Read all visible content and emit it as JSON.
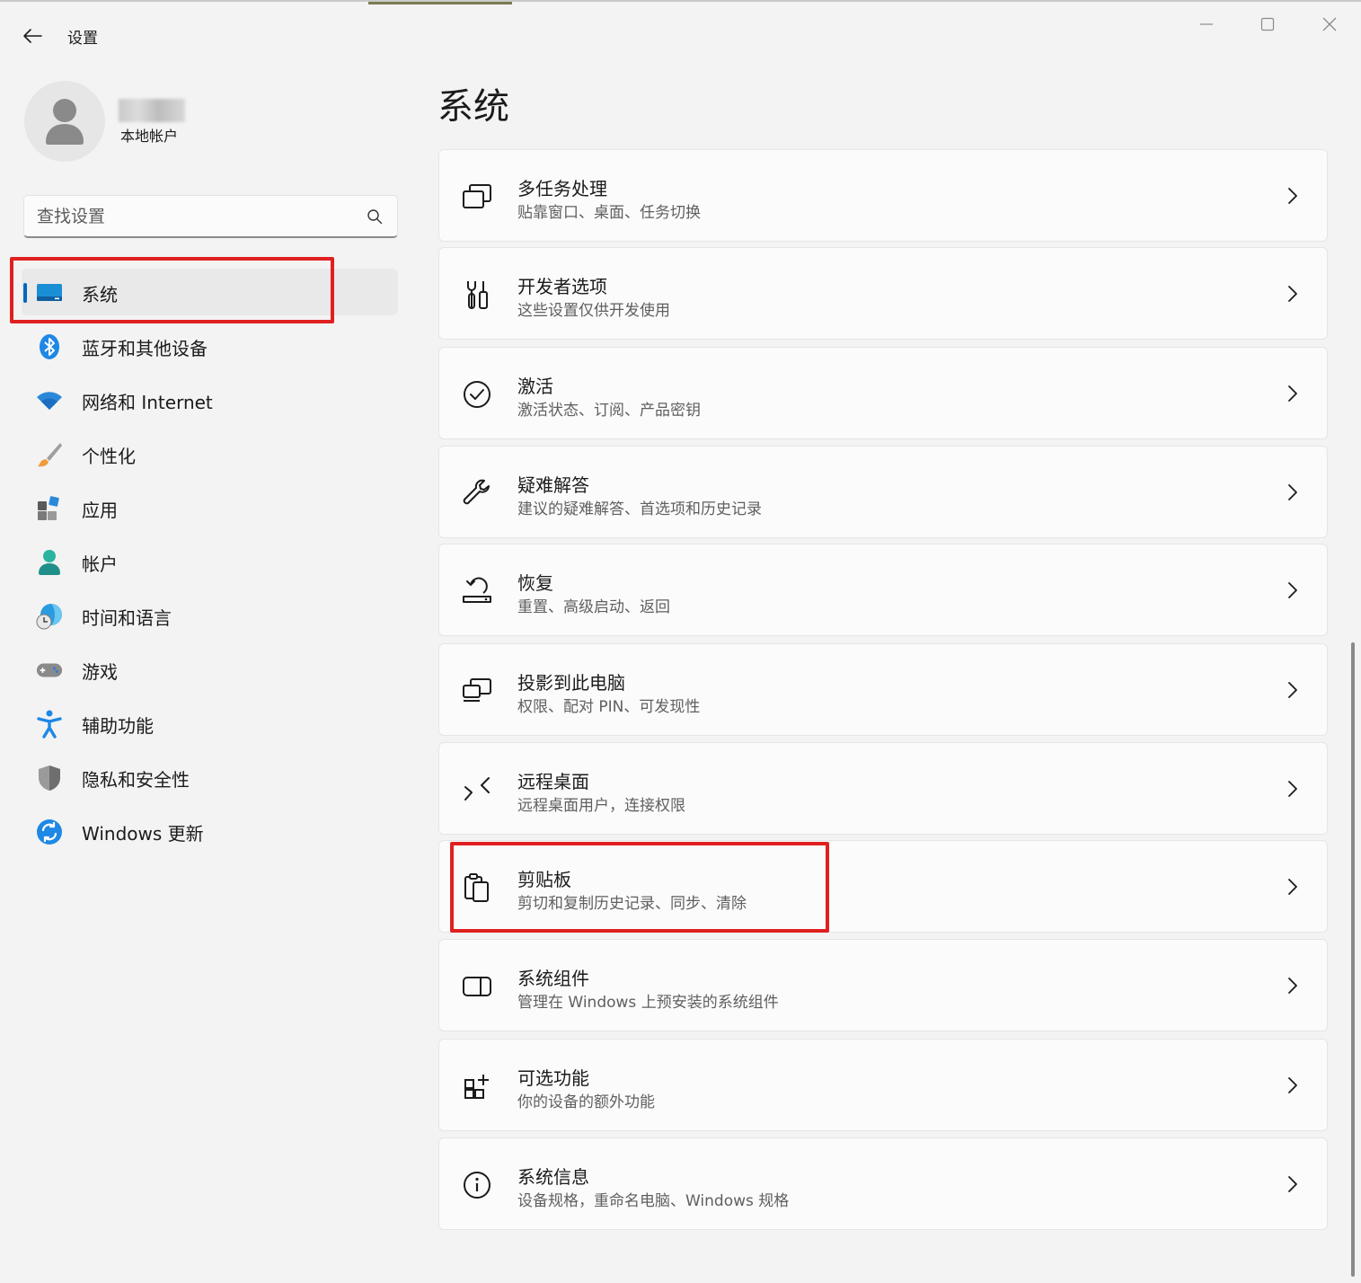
{
  "window": {
    "title": "设置",
    "controls": {
      "minimize": "minimize-icon",
      "maximize": "maximize-icon",
      "close": "close-icon"
    }
  },
  "profile": {
    "account_type": "本地帐户"
  },
  "search": {
    "placeholder": "查找设置"
  },
  "nav": {
    "items": [
      {
        "label": "系统",
        "icon": "system-display-icon",
        "active": true
      },
      {
        "label": "蓝牙和其他设备",
        "icon": "bluetooth-icon"
      },
      {
        "label": "网络和 Internet",
        "icon": "wifi-icon"
      },
      {
        "label": "个性化",
        "icon": "paintbrush-icon"
      },
      {
        "label": "应用",
        "icon": "apps-icon"
      },
      {
        "label": "帐户",
        "icon": "account-icon"
      },
      {
        "label": "时间和语言",
        "icon": "time-language-icon"
      },
      {
        "label": "游戏",
        "icon": "gamepad-icon"
      },
      {
        "label": "辅助功能",
        "icon": "accessibility-icon"
      },
      {
        "label": "隐私和安全性",
        "icon": "shield-icon"
      },
      {
        "label": "Windows 更新",
        "icon": "windows-update-icon"
      }
    ]
  },
  "main": {
    "title": "系统",
    "cards": [
      {
        "title": "多任务处理",
        "subtitle": "贴靠窗口、桌面、任务切换",
        "icon": "multitasking-icon"
      },
      {
        "title": "开发者选项",
        "subtitle": "这些设置仅供开发使用",
        "icon": "developer-tools-icon"
      },
      {
        "title": "激活",
        "subtitle": "激活状态、订阅、产品密钥",
        "icon": "activation-check-icon"
      },
      {
        "title": "疑难解答",
        "subtitle": "建议的疑难解答、首选项和历史记录",
        "icon": "wrench-icon"
      },
      {
        "title": "恢复",
        "subtitle": "重置、高级启动、返回",
        "icon": "recovery-icon"
      },
      {
        "title": "投影到此电脑",
        "subtitle": "权限、配对 PIN、可发现性",
        "icon": "project-to-pc-icon"
      },
      {
        "title": "远程桌面",
        "subtitle": "远程桌面用户，连接权限",
        "icon": "remote-desktop-icon"
      },
      {
        "title": "剪贴板",
        "subtitle": "剪切和复制历史记录、同步、清除",
        "icon": "clipboard-icon"
      },
      {
        "title": "系统组件",
        "subtitle": "管理在 Windows 上预安装的系统组件",
        "icon": "system-components-icon"
      },
      {
        "title": "可选功能",
        "subtitle": "你的设备的额外功能",
        "icon": "optional-features-icon"
      },
      {
        "title": "系统信息",
        "subtitle": "设备规格，重命名电脑、Windows 规格",
        "icon": "info-icon"
      }
    ]
  },
  "colors": {
    "accent": "#0067c0",
    "highlight": "#e02020",
    "background": "#f3f3f3",
    "card": "#fbfbfb"
  }
}
